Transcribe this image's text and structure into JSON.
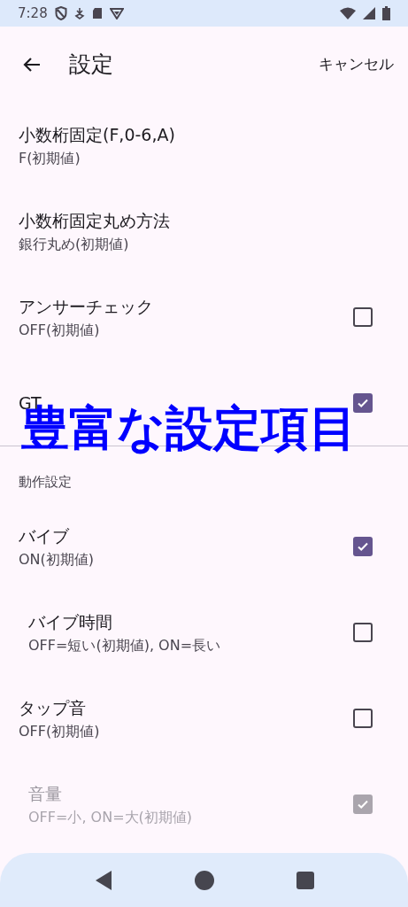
{
  "status_bar": {
    "time": "7:28"
  },
  "app_bar": {
    "title": "設定",
    "action": "キャンセル"
  },
  "sections": [
    {
      "items": [
        {
          "title": "小数桁固定(F,0-6,A)",
          "subtitle": "F(初期値)",
          "kind": "text",
          "disabled": false
        },
        {
          "title": "小数桁固定丸め方法",
          "subtitle": "銀行丸め(初期値)",
          "kind": "text",
          "disabled": false
        },
        {
          "title": "アンサーチェック",
          "subtitle": "OFF(初期値)",
          "kind": "checkbox",
          "checked": false,
          "disabled": false
        },
        {
          "title": "GT",
          "kind": "checkbox",
          "checked": true,
          "disabled": false
        }
      ]
    },
    {
      "header": "動作設定",
      "items": [
        {
          "title": "バイブ",
          "subtitle": "ON(初期値)",
          "kind": "checkbox",
          "checked": true,
          "disabled": false,
          "children": [
            {
              "title": "バイブ時間",
              "subtitle": "OFF=短い(初期値), ON=長い",
              "kind": "checkbox",
              "checked": false,
              "disabled": false
            }
          ]
        },
        {
          "title": "タップ音",
          "subtitle": "OFF(初期値)",
          "kind": "checkbox",
          "checked": false,
          "disabled": false,
          "children": [
            {
              "title": "音量",
              "subtitle": "OFF=小, ON=大(初期値)",
              "kind": "checkbox",
              "checked": true,
              "disabled": true
            }
          ]
        }
      ]
    }
  ],
  "caption": "豊富な設定項目"
}
